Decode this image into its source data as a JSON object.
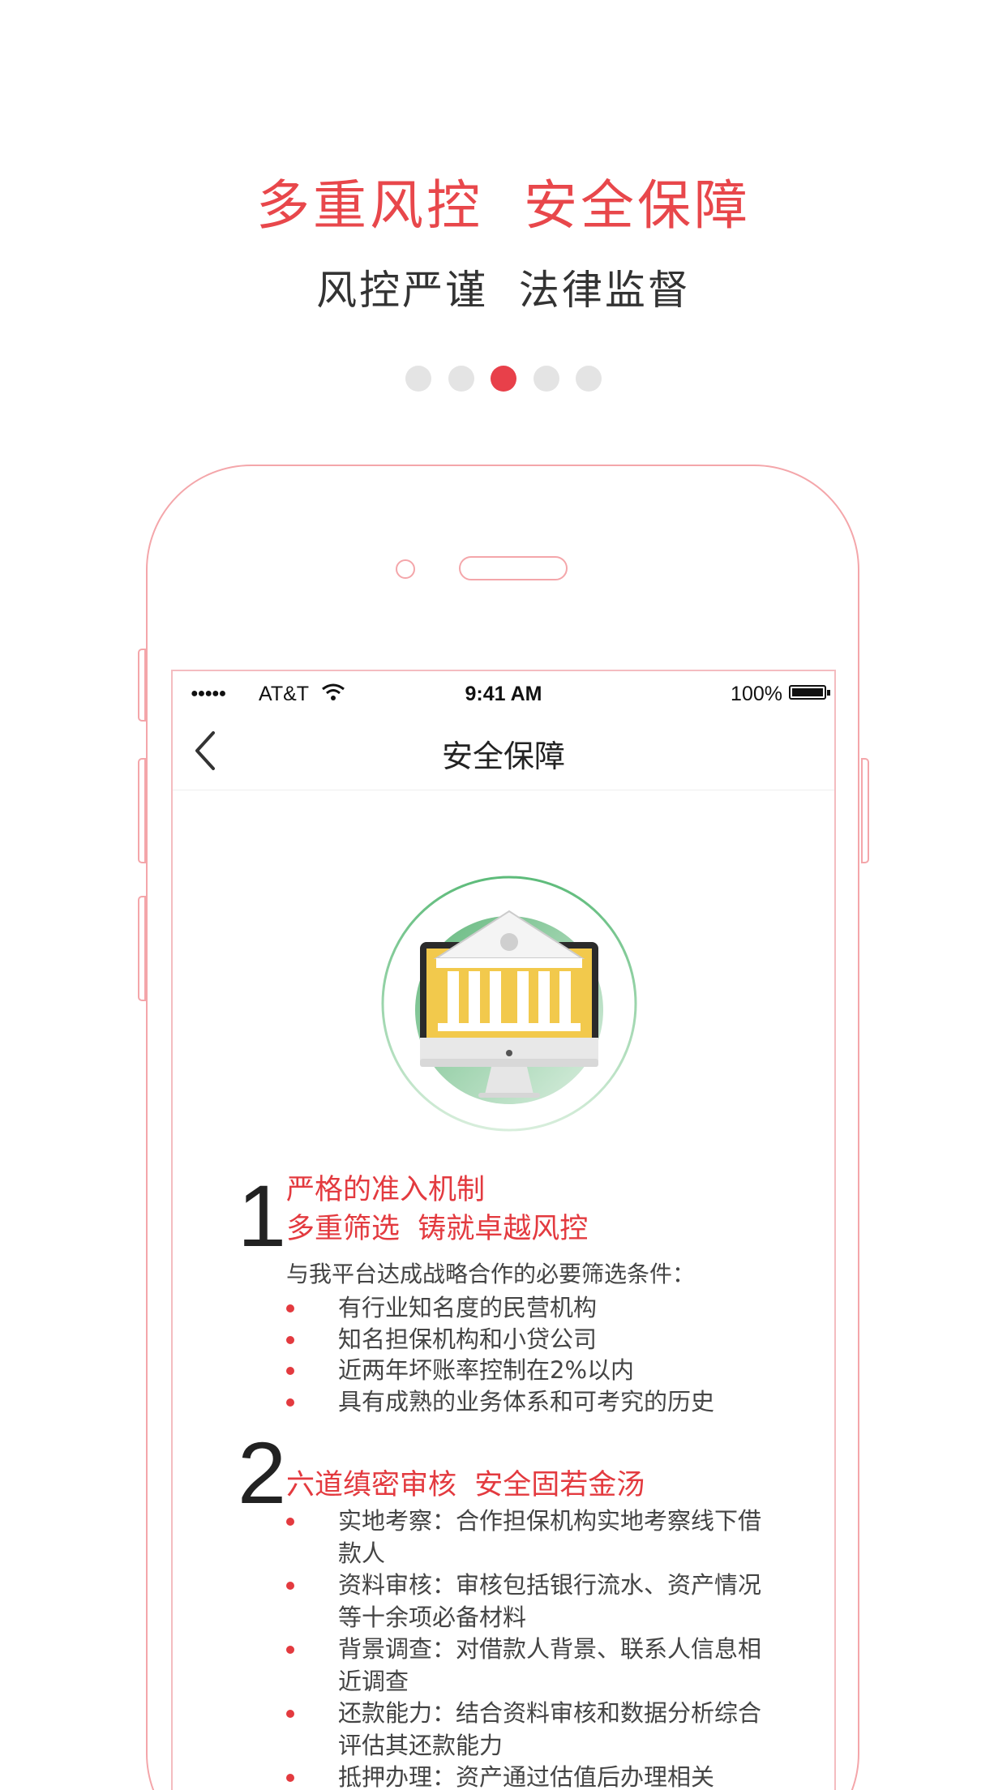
{
  "promo": {
    "headline": "多重风控  安全保障",
    "subline": "风控严谨  法律监督",
    "page_dots": {
      "count": 5,
      "active_index": 2
    }
  },
  "status_bar": {
    "signal": "●●●●●",
    "carrier": "AT&T",
    "time": "9:41 AM",
    "battery": "100%"
  },
  "nav": {
    "title": "安全保障",
    "back_icon": "chevron-left-icon"
  },
  "illustration": {
    "icon": "bank-on-monitor-icon",
    "accent_green": "#5dbb7a",
    "accent_yellow": "#f2c94c"
  },
  "section1": {
    "number": "1",
    "title": "严格的准入机制\n多重筛选  铸就卓越风控",
    "intro": "与我平台达成战略合作的必要筛选条件：",
    "items": [
      "有行业知名度的民营机构",
      "知名担保机构和小贷公司",
      "近两年坏账率控制在2%以内",
      "具有成熟的业务体系和可考究的历史"
    ]
  },
  "section2": {
    "number": "2",
    "title": "六道缜密审核  安全固若金汤",
    "items": [
      "实地考察：合作担保机构实地考察线下借款人",
      "资料审核：审核包括银行流水、资产情况等十余项必备材料",
      "背景调查：对借款人背景、联系人信息相近调查",
      "还款能力：结合资料审核和数据分析综合评估其还款能力",
      "抵押办理：资产通过估值后办理相关"
    ]
  },
  "colors": {
    "brand_red": "#e8474b",
    "frame_pink": "#f4a6aa",
    "dot_inactive": "#e4e4e4"
  }
}
